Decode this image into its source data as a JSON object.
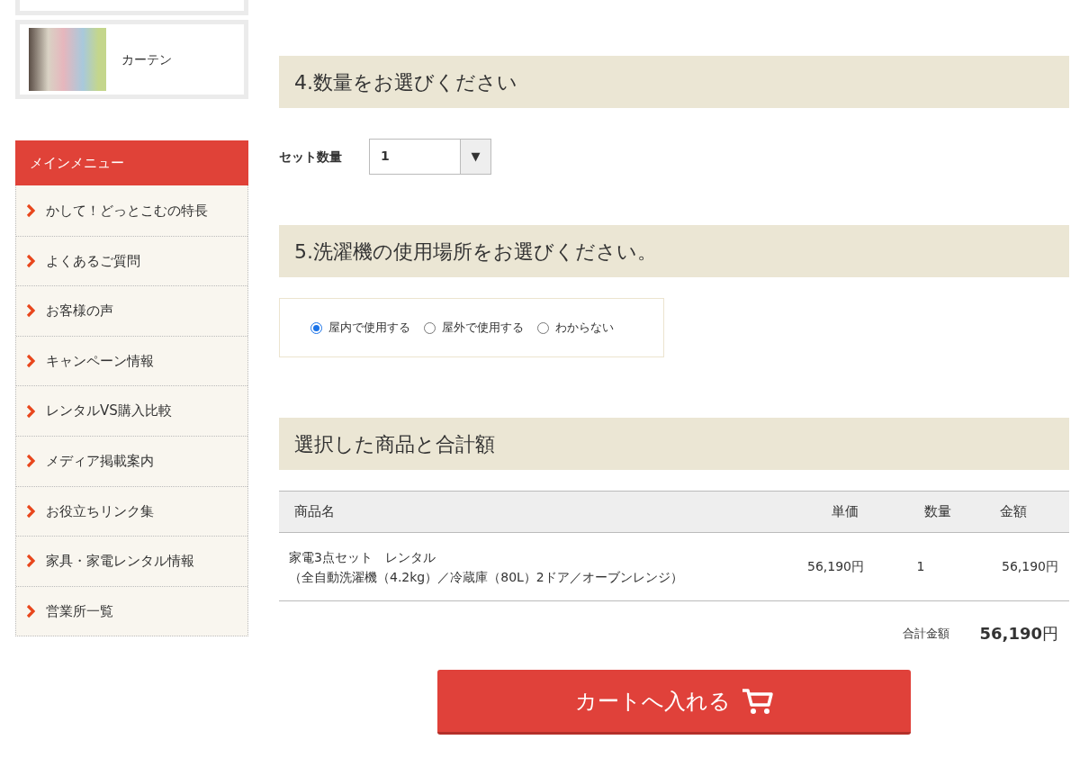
{
  "sidebar": {
    "category_cards": [
      {
        "label": "カーテン"
      }
    ],
    "menu": {
      "title": "メインメニュー",
      "items": [
        {
          "label": "かして！どっとこむの特長"
        },
        {
          "label": "よくあるご質問"
        },
        {
          "label": "お客様の声"
        },
        {
          "label": "キャンペーン情報"
        },
        {
          "label": "レンタルVS購入比較"
        },
        {
          "label": "メディア掲載案内"
        },
        {
          "label": "お役立ちリンク集"
        },
        {
          "label": "家具・家電レンタル情報"
        },
        {
          "label": "営業所一覧"
        }
      ]
    }
  },
  "quantity_section": {
    "heading": "4.数量をお選びください",
    "label": "セット数量",
    "value": "1",
    "dropdown_glyph": "▼"
  },
  "location_section": {
    "heading": "5.洗濯機の使用場所をお選びください。",
    "options": [
      {
        "label": "屋内で使用する",
        "selected": true
      },
      {
        "label": "屋外で使用する",
        "selected": false
      },
      {
        "label": "わからない",
        "selected": false
      }
    ]
  },
  "summary_section": {
    "heading": "選択した商品と合計額",
    "table": {
      "columns": [
        "商品名",
        "単価",
        "数量",
        "金額"
      ],
      "rows": [
        {
          "name_lines": [
            "家電3点セット　レンタル",
            "（全自動洗濯機（4.2kg）／冷蔵庫（80L）2ドア／オーブンレンジ）"
          ],
          "unit_price": "56,190円",
          "quantity": "1",
          "amount": "56,190円"
        }
      ]
    },
    "total_label": "合計金額",
    "total_value": "56,190",
    "total_unit": "円",
    "cart_button": "カートへ入れる"
  }
}
